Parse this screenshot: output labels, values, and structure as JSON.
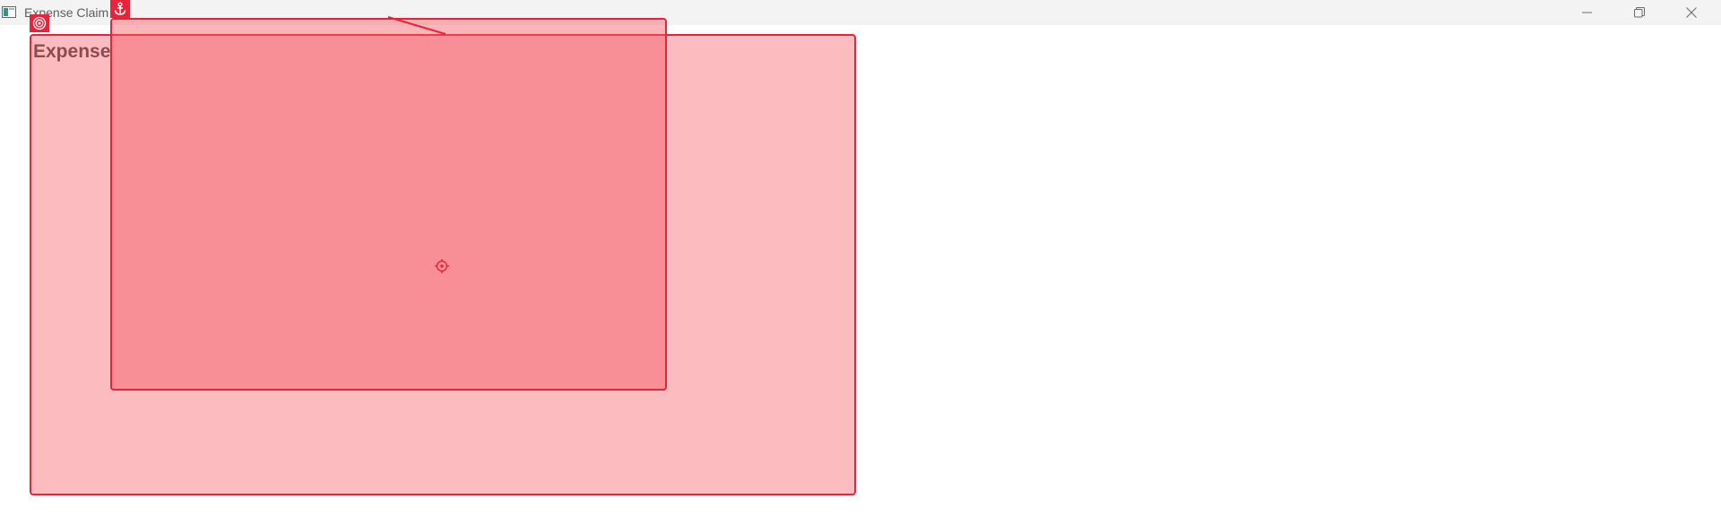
{
  "window": {
    "title": "Expense Claim",
    "icon": "app-window-icon",
    "controls": {
      "minimize": "minimize-icon",
      "maximize": "restore-icon",
      "close": "close-icon"
    }
  },
  "page": {
    "heading": "Expense"
  },
  "overlays": {
    "outer_badge_icon": "target-icon",
    "inner_badge_icon": "anchor-icon",
    "center_marker_icon": "crosshair-icon",
    "highlight_color": "#e7243a"
  }
}
